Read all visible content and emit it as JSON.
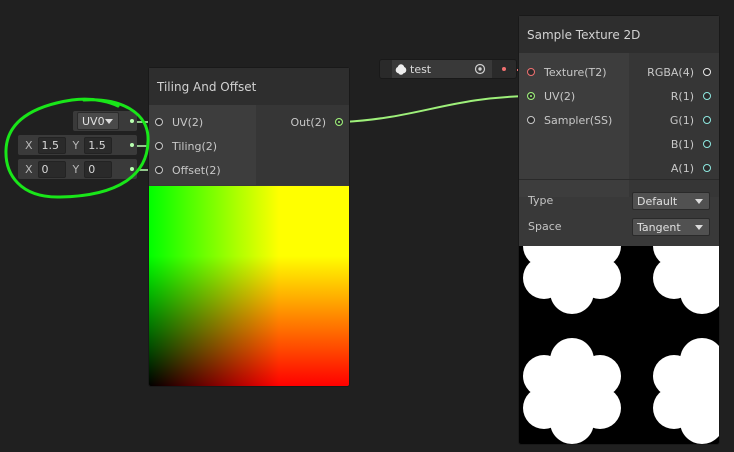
{
  "tiling_node": {
    "title": "Tiling And Offset",
    "inputs": [
      "UV(2)",
      "Tiling(2)",
      "Offset(2)"
    ],
    "output": "Out(2)"
  },
  "inline_inputs": {
    "uv_channel": "UV0",
    "tiling": {
      "x_label": "X",
      "x": "1.5",
      "y_label": "Y",
      "y": "1.5"
    },
    "offset": {
      "x_label": "X",
      "x": "0",
      "y_label": "Y",
      "y": "0"
    }
  },
  "texture_property": {
    "name": "test"
  },
  "sample_node": {
    "title": "Sample Texture 2D",
    "inputs": [
      "Texture(T2)",
      "UV(2)",
      "Sampler(SS)"
    ],
    "outputs": [
      "RGBA(4)",
      "R(1)",
      "G(1)",
      "B(1)",
      "A(1)"
    ],
    "settings": [
      {
        "label": "Type",
        "value": "Default"
      },
      {
        "label": "Space",
        "value": "Tangent"
      }
    ]
  },
  "colors": {
    "canvas": "#202020",
    "node_body": "#393939",
    "node_header": "#2e2e2e",
    "vector2_port": "#9ef07a",
    "texture_port": "#f07070",
    "float_port": "#8ee8e0",
    "annotation_circle": "#19e619"
  },
  "icons": {
    "texture_icon": "cloud-icon",
    "object_picker": "target-icon",
    "annotation": "hand-drawn-circle"
  }
}
